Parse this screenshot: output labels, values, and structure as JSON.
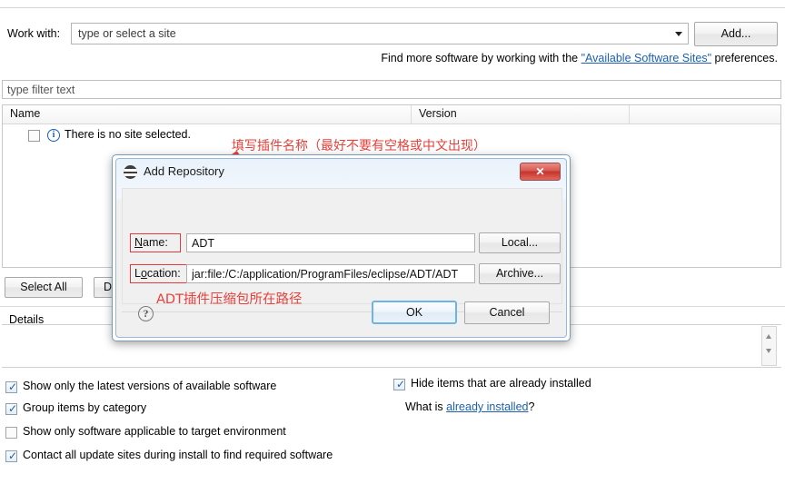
{
  "header": {
    "work_with_label": "Work with:",
    "work_with_value": "type or select a site",
    "add_button": "Add...",
    "find_more_prefix": "Find more software by working with the ",
    "find_more_link": "\"Available Software Sites\"",
    "find_more_suffix": " preferences."
  },
  "filter": {
    "placeholder": "type filter text"
  },
  "table": {
    "columns": [
      "Name",
      "Version",
      ""
    ],
    "rows": [
      {
        "name": "There is no site selected.",
        "version": ""
      }
    ]
  },
  "actions": {
    "select_all": "Select All",
    "deselect_all": "De"
  },
  "details": {
    "label": "Details",
    "content": ""
  },
  "options": {
    "show_latest": "Show only the latest versions of available software",
    "group_by_category": "Group items by category",
    "show_applicable": "Show only software applicable to target environment",
    "contact_all": "Contact all update sites during install to find required software",
    "hide_installed": "Hide items that are already installed",
    "what_is_prefix": "What is ",
    "what_is_link": "already installed",
    "what_is_suffix": "?"
  },
  "dialog": {
    "title": "Add Repository",
    "close_glyph": "✕",
    "name_label": "Name:",
    "name_label_mnemonic": "N",
    "name_value": "ADT",
    "location_label": "Location:",
    "location_label_mnemonic": "L",
    "location_value": "jar:file:/C:/application/ProgramFiles/eclipse/ADT/ADT",
    "local_button": "Local...",
    "archive_button": "Archive...",
    "help_glyph": "?",
    "ok_button": "OK",
    "cancel_button": "Cancel"
  },
  "annotations": {
    "name_note": "填写插件名称（最好不要有空格或中文出现）",
    "location_note": "ADT插件压缩包所在路径",
    "color": "#e8403a"
  }
}
